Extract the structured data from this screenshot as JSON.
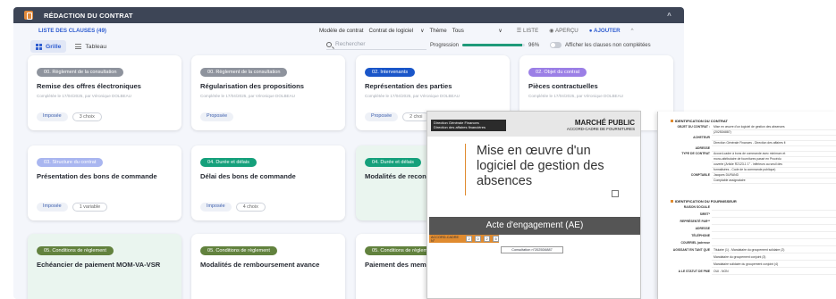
{
  "header": {
    "title": "RÉDACTION DU CONTRAT"
  },
  "toolbar": {
    "list_title": "LISTE DES CLAUSES (49)",
    "model_label": "Modèle de contrat",
    "model_value": "Contrat de logiciel",
    "theme_label": "Thème",
    "theme_value": "Tous",
    "view_list": "☰ LISTE",
    "view_preview": "◉ APERÇU",
    "view_add": "● AJOUTER"
  },
  "subbar": {
    "tab_grid": "Grille",
    "tab_table": "Tableau",
    "search_placeholder": "Rechercher",
    "progress_label": "Progression",
    "progress_value": "96%",
    "progress_fraction": 0.96,
    "toggle_label": "Afficher les clauses non complétées"
  },
  "cards": [
    {
      "badge": "00. Règlement de la consultation",
      "badge_style": "gray",
      "title": "Remise des offres électroniques",
      "meta": "Complétée le 17/04/2025, par Véronique DOLBEAU",
      "pills": [
        {
          "text": "Imposée",
          "style": "lab"
        },
        {
          "text": "3 choix",
          "style": "pill"
        }
      ],
      "green": false
    },
    {
      "badge": "00. Règlement de la consultation",
      "badge_style": "gray",
      "title": "Régularisation des propositions",
      "meta": "Complétée le 17/04/2025, par Véronique DOLBEAU",
      "pills": [
        {
          "text": "Proposée",
          "style": "lab"
        }
      ],
      "green": false
    },
    {
      "badge": "02. Intervenants",
      "badge_style": "blue",
      "title": "Représentation des parties",
      "meta": "Complétée le 17/04/2025, par Véronique DOLBEAU",
      "pills": [
        {
          "text": "Proposée",
          "style": "lab"
        },
        {
          "text": "2 choi",
          "style": "pill"
        }
      ],
      "green": false
    },
    {
      "badge": "02. Objet du contrat",
      "badge_style": "purple",
      "title": "Pièces contractuelles",
      "meta": "Complétée le 17/04/2025, par Véronique DOLBEAU",
      "pills": [],
      "green": false
    },
    {
      "badge": "03. Structure du contrat",
      "badge_style": "lav",
      "title": "Présentation des bons de commande",
      "meta": "",
      "pills": [
        {
          "text": "Imposée",
          "style": "lab"
        },
        {
          "text": "1 variable",
          "style": "pill"
        }
      ],
      "green": false
    },
    {
      "badge": "04. Durée et délais",
      "badge_style": "teal",
      "title": "Délai des bons de commande",
      "meta": "",
      "pills": [
        {
          "text": "Imposée",
          "style": "lab"
        },
        {
          "text": "4 choix",
          "style": "pill"
        }
      ],
      "green": false
    },
    {
      "badge": "04. Durée et délais",
      "badge_style": "teal",
      "title": "Modalités de recondu",
      "meta": "",
      "pills": [],
      "green": true
    },
    {
      "badge": "05. Conditions de règlement",
      "badge_style": "olive",
      "title": "Echéancier de paiement MOM-VA-VSR",
      "meta": "",
      "pills": [],
      "green": true
    },
    {
      "badge": "05. Conditions de règlement",
      "badge_style": "olive",
      "title": "Modalités de remboursement avance",
      "meta": "",
      "pills": [],
      "green": false
    },
    {
      "badge": "05. Conditions de règlem",
      "badge_style": "olive",
      "title": "Paiement des memb",
      "meta": "",
      "pills": [],
      "green": false
    }
  ],
  "doc_left": {
    "org_line1": "Direction Générale Finances",
    "org_line2": "Direction des affaires financières",
    "mp_title": "MARCHÉ PUBLIC",
    "mp_sub": "ACCORD-CADRE DE FOURNITURES",
    "title_l1": "Mise en œuvre d'un",
    "title_l2": "logiciel de gestion des",
    "title_l3": "absences",
    "ae": "Acte d'engagement (AE)",
    "acc_label": "ACCORD-CADRE N°",
    "acc_nums": [
      "2",
      "0",
      "2",
      "5"
    ],
    "consultation": "Consultation n°2025D6887"
  },
  "doc_right": {
    "sec1": "IDENTIFICATION DU CONTRAT",
    "rows1": [
      {
        "k": "OBJET DU CONTRAT :",
        "v": "Mise en œuvre d'un logiciel de gestion des absences"
      },
      {
        "k": "",
        "v": "(2025D6887)"
      },
      {
        "k": "ACHETEUR",
        "v": ""
      },
      {
        "k": "",
        "v": "Direction Générale Finances - Direction des affaires fi"
      },
      {
        "k": "ADRESSE",
        "v": ""
      },
      {
        "k": "TYPE DE CONTRAT",
        "v": "Accord-cadre à bons de commande avec minimum et"
      },
      {
        "k": "",
        "v": "mono-attributaire de fournitures passé en Procédu"
      },
      {
        "k": "",
        "v": "ouverte (Article R2123-1 1° - inférieurs au seuil des"
      },
      {
        "k": "",
        "v": "formalisées - Code de la commande publique)"
      },
      {
        "k": "COMPTABLE",
        "v": "Jacques DURAND"
      },
      {
        "k": "",
        "v": "Comptable assignataire"
      }
    ],
    "sec2": "IDENTIFICATION DU FOURNISSEUR",
    "rows2": [
      {
        "k": "RAISON SOCIALE",
        "v": ""
      },
      {
        "k": "SIRET*",
        "v": ""
      },
      {
        "k": "REPRÉSENTÉ PAR**",
        "v": ""
      },
      {
        "k": "ADRESSE",
        "v": ""
      },
      {
        "k": "TÉLÉPHONE",
        "v": ""
      },
      {
        "k": "COURRIEL (adresse",
        "v": ""
      },
      {
        "k": "AGISSANT EN TANT QUE",
        "v": "Titulaire (1) - Mandataire du groupement solidaire (2)"
      },
      {
        "k": "",
        "v": "Mandataire du groupement conjoint (3)"
      },
      {
        "k": "",
        "v": "Mandataire solidaire du groupement conjoint (4)"
      },
      {
        "k": "A LE STATUT DE PME",
        "v": "OUI - NON"
      }
    ]
  }
}
